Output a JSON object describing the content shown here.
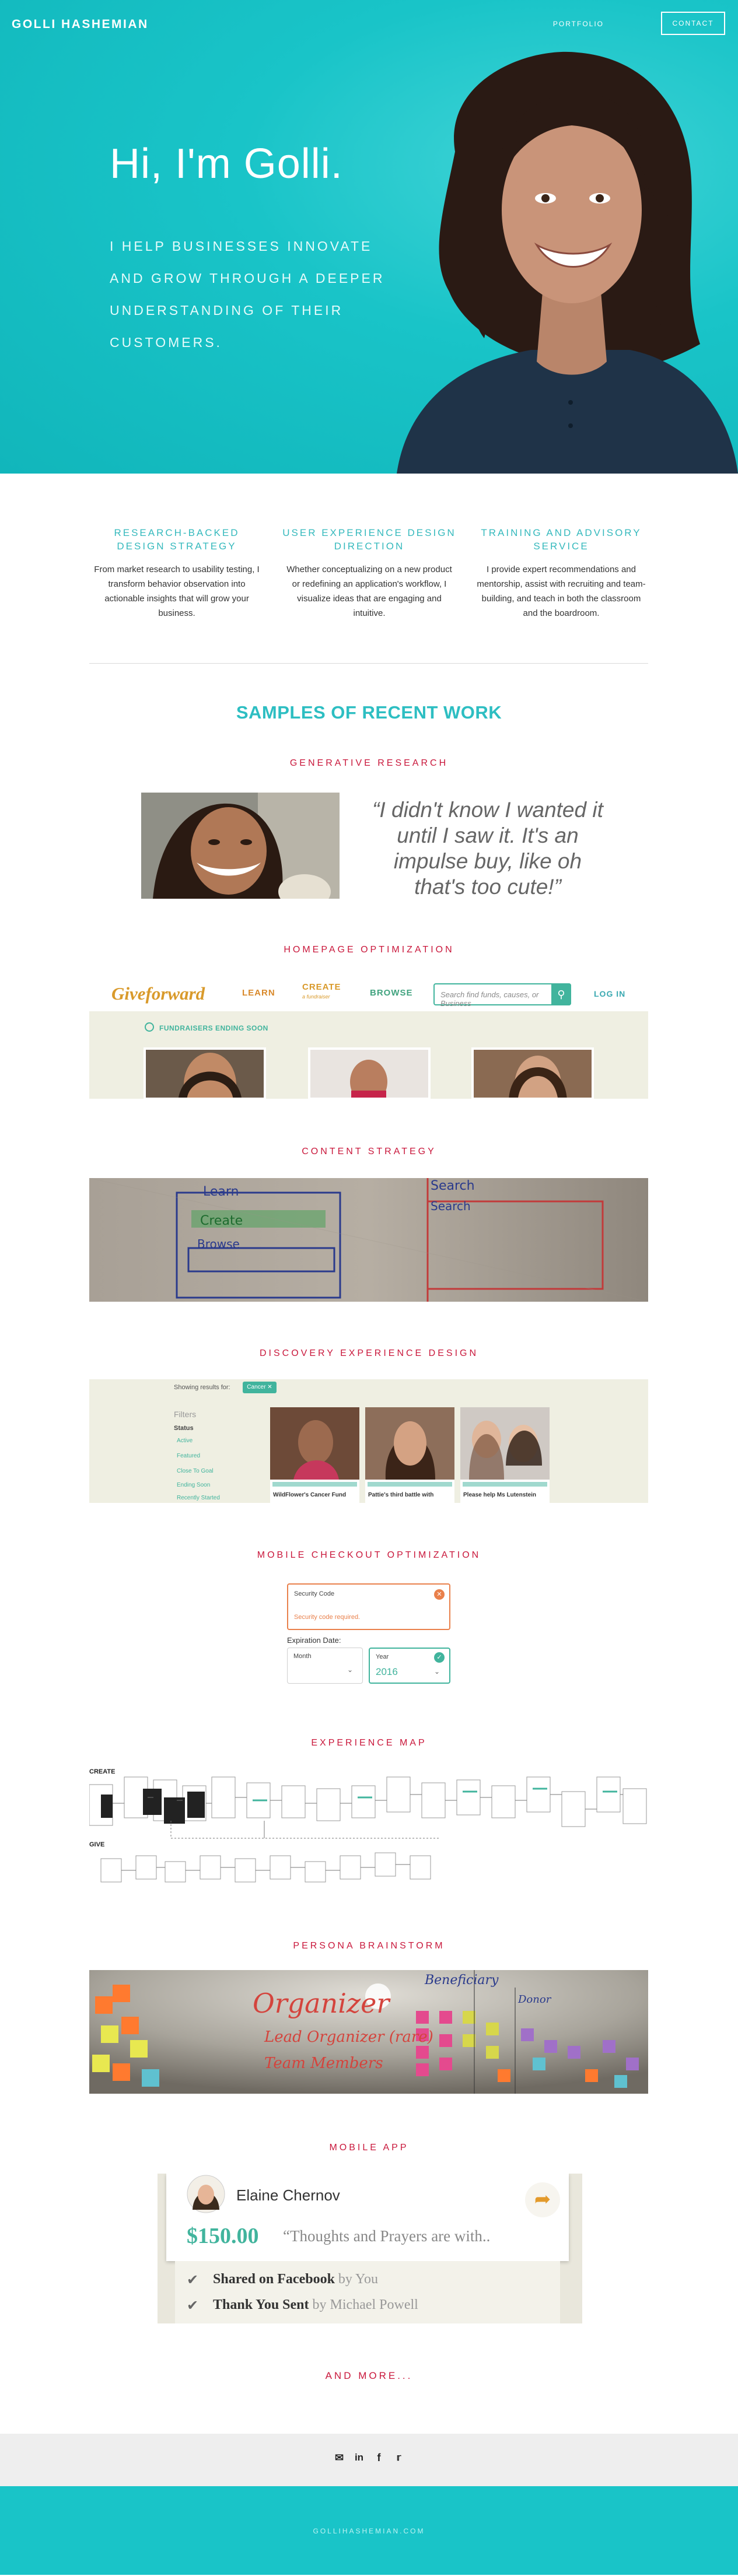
{
  "header": {
    "logo": "GOLLI HASHEMIAN",
    "nav_portfolio": "PORTFOLIO",
    "nav_contact": "CONTACT"
  },
  "hero": {
    "title": "Hi, I'm Golli.",
    "subtitle": "I HELP BUSINESSES INNOVATE AND GROW THROUGH A DEEPER UNDERSTANDING OF THEIR CUSTOMERS."
  },
  "services": [
    {
      "title": "RESEARCH-BACKED DESIGN STRATEGY",
      "text": "From market research to usability testing, I transform behavior observation into actionable insights that will grow your business."
    },
    {
      "title": "USER EXPERIENCE DESIGN DIRECTION",
      "text": "Whether conceptualizing on a new product or redefining an application's workflow, I visualize ideas that are engaging and intuitive."
    },
    {
      "title": "TRAINING AND ADVISORY SERVICE",
      "text": "I provide expert recommendations and mentorship, assist with recruiting and team-building, and teach in both the classroom and the boardroom."
    }
  ],
  "samples_title": "SAMPLES OF RECENT WORK",
  "sections": {
    "generative": {
      "label": "GENERATIVE RESEARCH",
      "quote": "“I didn't know I wanted it until I saw it. It's an impulse buy, like oh that's too cute!”"
    },
    "homepage": {
      "label": "HOMEPAGE OPTIMIZATION",
      "logo": "Giveforward",
      "nav_learn": "LEARN",
      "nav_create": "CREATE",
      "nav_create_sub": "a fundraiser",
      "nav_browse": "BROWSE",
      "search_placeholder": "Search find funds, causes, or Business",
      "login": "LOG IN",
      "ending_soon": "FUNDRAISERS ENDING SOON"
    },
    "content": {
      "label": "CONTENT STRATEGY",
      "whiteboard_words": [
        "Learn",
        "Create",
        "Browse",
        "Search",
        "Search"
      ]
    },
    "discovery": {
      "label": "DISCOVERY EXPERIENCE DESIGN",
      "showing": "Showing results for:",
      "pill": "Cancer ✕",
      "filters": "Filters",
      "status": "Status",
      "options": [
        "Active",
        "Featured",
        "Close To Goal",
        "Ending Soon",
        "Recently Started"
      ],
      "cards": [
        "WildFlower's Cancer Fund",
        "Pattie's third battle with",
        "Please help Ms Lutenstein"
      ]
    },
    "mobile_checkout": {
      "label": "MOBILE CHECKOUT OPTIMIZATION",
      "security_code": "Security Code",
      "error": "Security code required.",
      "expiration": "Expiration Date:",
      "month_label": "Month",
      "year_label": "Year",
      "year_value": "2016"
    },
    "experience_map": {
      "label": "EXPERIENCE MAP",
      "create": "CREATE",
      "give": "GIVE"
    },
    "persona": {
      "label": "PERSONA BRAINSTORM",
      "word_main": "Organizer",
      "word_lead": "Lead Organizer (rare)",
      "word_team": "Team Members",
      "word_bene": "Beneficiary",
      "word_donor": "Donor"
    },
    "mobile_app": {
      "label": "MOBILE APP",
      "name": "Elaine Chernov",
      "amount": "$150.00",
      "message": "“Thoughts and Prayers are with..",
      "row1_bold": "Shared on Facebook",
      "row1_muted": "by You",
      "row2_bold": "Thank You Sent",
      "row2_muted": "by Michael Powell"
    }
  },
  "and_more": "AND MORE...",
  "footer": {
    "icons": [
      "mail-icon",
      "linkedin-icon",
      "facebook-icon",
      "twitter-icon"
    ],
    "site": "GOLLIHASHEMIAN.COM"
  },
  "colors": {
    "teal": "#19c4c8",
    "crimson": "#c9173b",
    "green": "#41b49d"
  }
}
